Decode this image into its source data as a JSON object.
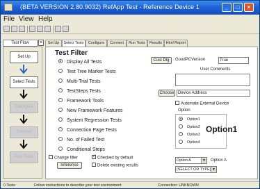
{
  "window": {
    "title": "(BETA VERSION 2.80.9032) RefApp Test - Reference Device 1",
    "min_glyph": "_",
    "max_glyph": "□",
    "close_glyph": "×"
  },
  "menu": [
    "File",
    "View",
    "Help"
  ],
  "toolbar_icons": [
    "new-icon",
    "open-icon",
    "save-icon",
    "cut-icon",
    "copy-icon",
    "paste-icon",
    "print-icon",
    "help-icon"
  ],
  "flow": {
    "tab_label": "Test Flow",
    "close_glyph": "×",
    "steps": [
      {
        "label": "Set Up",
        "state": "active"
      },
      {
        "label": "Select Tests",
        "state": "active"
      },
      {
        "label": "Configure",
        "state": "dim"
      },
      {
        "label": "Connect",
        "state": "dim"
      },
      {
        "label": "Run Tests",
        "state": "dim"
      }
    ]
  },
  "tabs": [
    "Set Up",
    "Select Tests",
    "Configure",
    "Connect",
    "Run Tests",
    "Results",
    "Html Report"
  ],
  "test_filter": {
    "title": "Test Filter",
    "options": [
      {
        "label": "Display All Tests",
        "selected": true
      },
      {
        "label": "Test Tree Marker Tests",
        "selected": false
      },
      {
        "label": "Multi-Trial Tests",
        "selected": false
      },
      {
        "label": "TestSteps Tests",
        "selected": false
      },
      {
        "label": "Framework Tools",
        "selected": false
      },
      {
        "label": "New Framework Features",
        "selected": false
      },
      {
        "label": "System Regression Tests",
        "selected": false
      },
      {
        "label": "Connection Page Tests",
        "selected": false
      },
      {
        "label": "No. of Failed Test",
        "selected": false
      },
      {
        "label": "Conditional Steps",
        "selected": false
      }
    ]
  },
  "bottom_controls": {
    "change_filter_label": "Change filter",
    "checked_by_default_label": "Checked by default",
    "reference_button": "reference",
    "delete_existing_label": "Delete existing results"
  },
  "right": {
    "cust_dlg_button": "Cust Dlg",
    "good_pc_version_label": "GoodPCVersion",
    "good_pc_version_value": "True",
    "user_comments_label": "User Comments",
    "user_comments_value": "",
    "choose_button": "Choose",
    "device_address_placeholder": "Device Address",
    "automate_external_device_label": "Automate External Device",
    "option_group_label": "Option",
    "option_items": [
      {
        "label": "Option1",
        "selected": true
      },
      {
        "label": "Option2",
        "selected": false
      },
      {
        "label": "Option3",
        "selected": false
      },
      {
        "label": "Option4",
        "selected": false
      }
    ],
    "option_display": "Option1",
    "option_select_value": "Option A",
    "option_select_label": "Option A",
    "type_select_value": "(SELECT OR TYPE)"
  },
  "status": {
    "tests": "0 Tests",
    "message": "Follow instructions to describe your test environment",
    "connection": "Connection: UNKNOWN"
  }
}
